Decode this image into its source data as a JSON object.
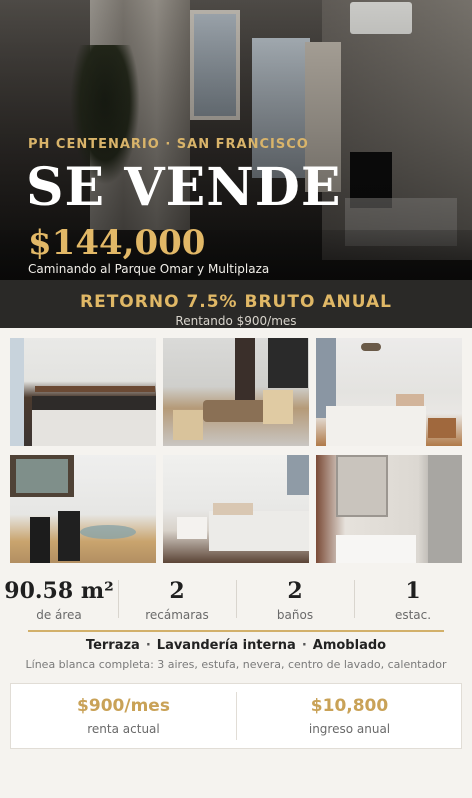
{
  "hero": {
    "eyebrow": "PH CENTENARIO  ·  SAN FRANCISCO",
    "headline": "SE VENDE",
    "price": "$144,000",
    "tagline": "Caminando al Parque Omar y Multiplaza"
  },
  "return_band": {
    "title": "RETORNO 7.5% BRUTO ANUAL",
    "subtitle": "Rentando $900/mes"
  },
  "photos": [
    {
      "icon": "kitchen-photo"
    },
    {
      "icon": "dining-room-photo"
    },
    {
      "icon": "bedroom-photo"
    },
    {
      "icon": "terrace-photo"
    },
    {
      "icon": "second-bedroom-photo"
    },
    {
      "icon": "bathroom-photo"
    }
  ],
  "stats": [
    {
      "value": "90.58 m²",
      "label": "de área"
    },
    {
      "value": "2",
      "label": "recámaras"
    },
    {
      "value": "2",
      "label": "baños"
    },
    {
      "value": "1",
      "label": "estac."
    }
  ],
  "features": {
    "items": [
      "Terraza",
      "Lavandería interna",
      "Amoblado"
    ],
    "separator": "·",
    "appliances": "Línea blanca completa: 3 aires, estufa, nevera, centro de lavado, calentador"
  },
  "rent": {
    "monthly_value": "$900/mes",
    "monthly_label": "renta actual",
    "annual_value": "$10,800",
    "annual_label": "ingreso anual"
  },
  "colors": {
    "gold": "#e0b866",
    "dark_band": "#2a2927",
    "background": "#f5f3ef"
  }
}
